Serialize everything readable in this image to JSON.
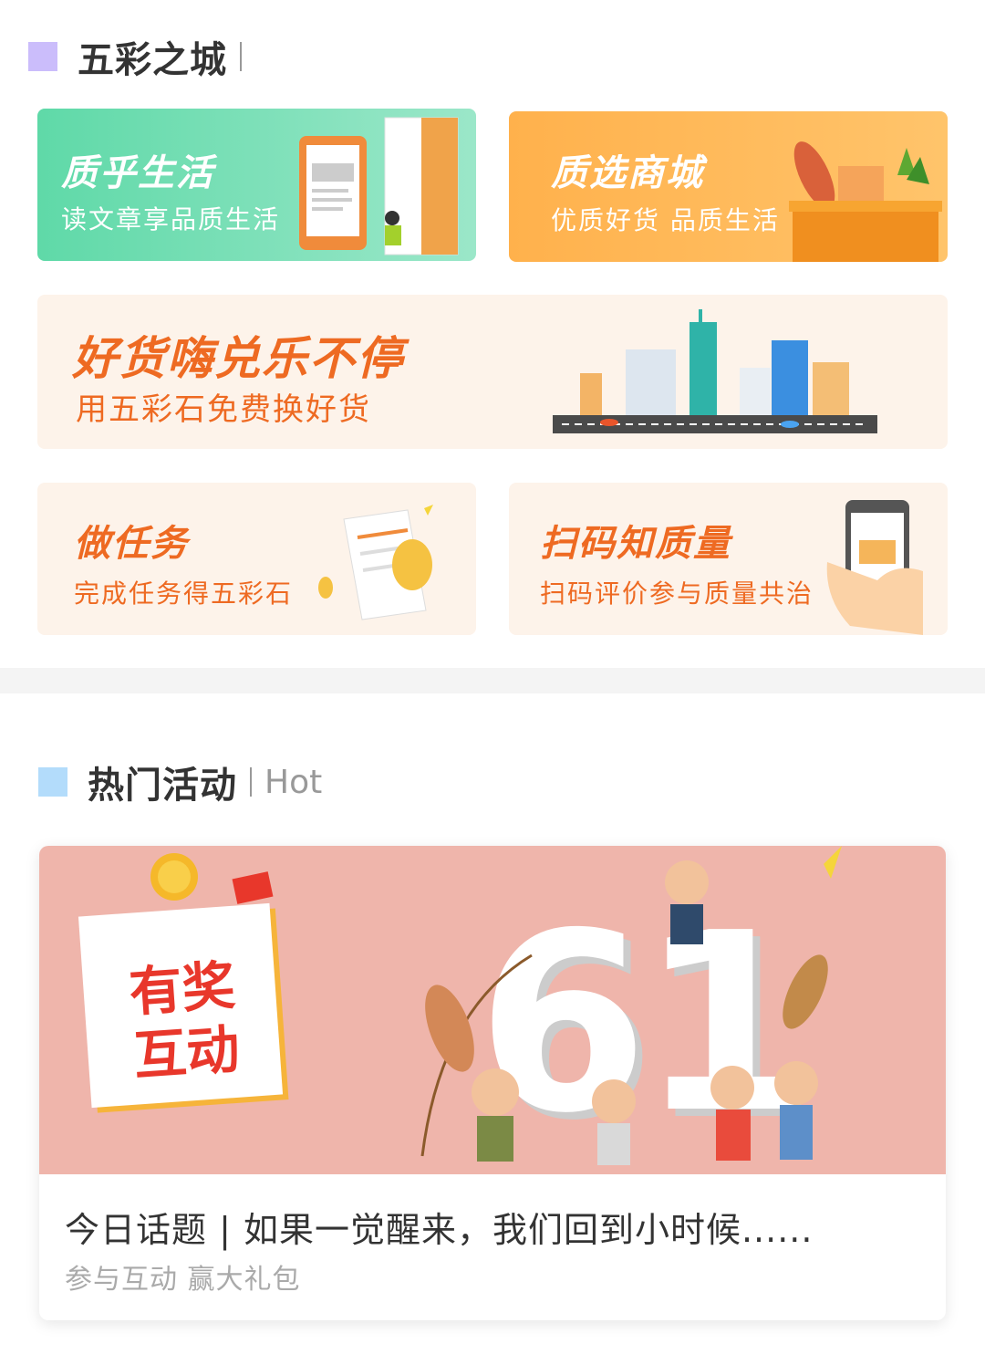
{
  "sections": {
    "city": {
      "title": "五彩之城",
      "subtitle": "",
      "square_color": "#cbbdfb"
    },
    "hot": {
      "title": "热门活动",
      "subtitle": "Hot",
      "square_color": "#b3dcfb"
    }
  },
  "cards": {
    "zhihu_life": {
      "title": "质乎生活",
      "subtitle": "读文章享品质生活",
      "icon": "book-tablet-illustration"
    },
    "mall": {
      "title": "质选商城",
      "subtitle": "优质好货 品质生活",
      "icon": "grocery-basket-illustration"
    },
    "exchange": {
      "title": "好货嗨兑乐不停",
      "subtitle": "用五彩石免费换好货",
      "icon": "city-skyline-illustration"
    },
    "tasks": {
      "title": "做任务",
      "subtitle": "完成任务得五彩石",
      "icon": "document-coins-illustration"
    },
    "scan": {
      "title": "扫码知质量",
      "subtitle": "扫码评价参与质量共治",
      "icon": "phone-scan-illustration"
    }
  },
  "promo": {
    "badge_line1": "有奖",
    "badge_line2": "互动",
    "banner_number": "61",
    "title": "今日话题 | 如果一觉醒来，我们回到小时候......",
    "subtitle": "参与互动  赢大礼包"
  }
}
